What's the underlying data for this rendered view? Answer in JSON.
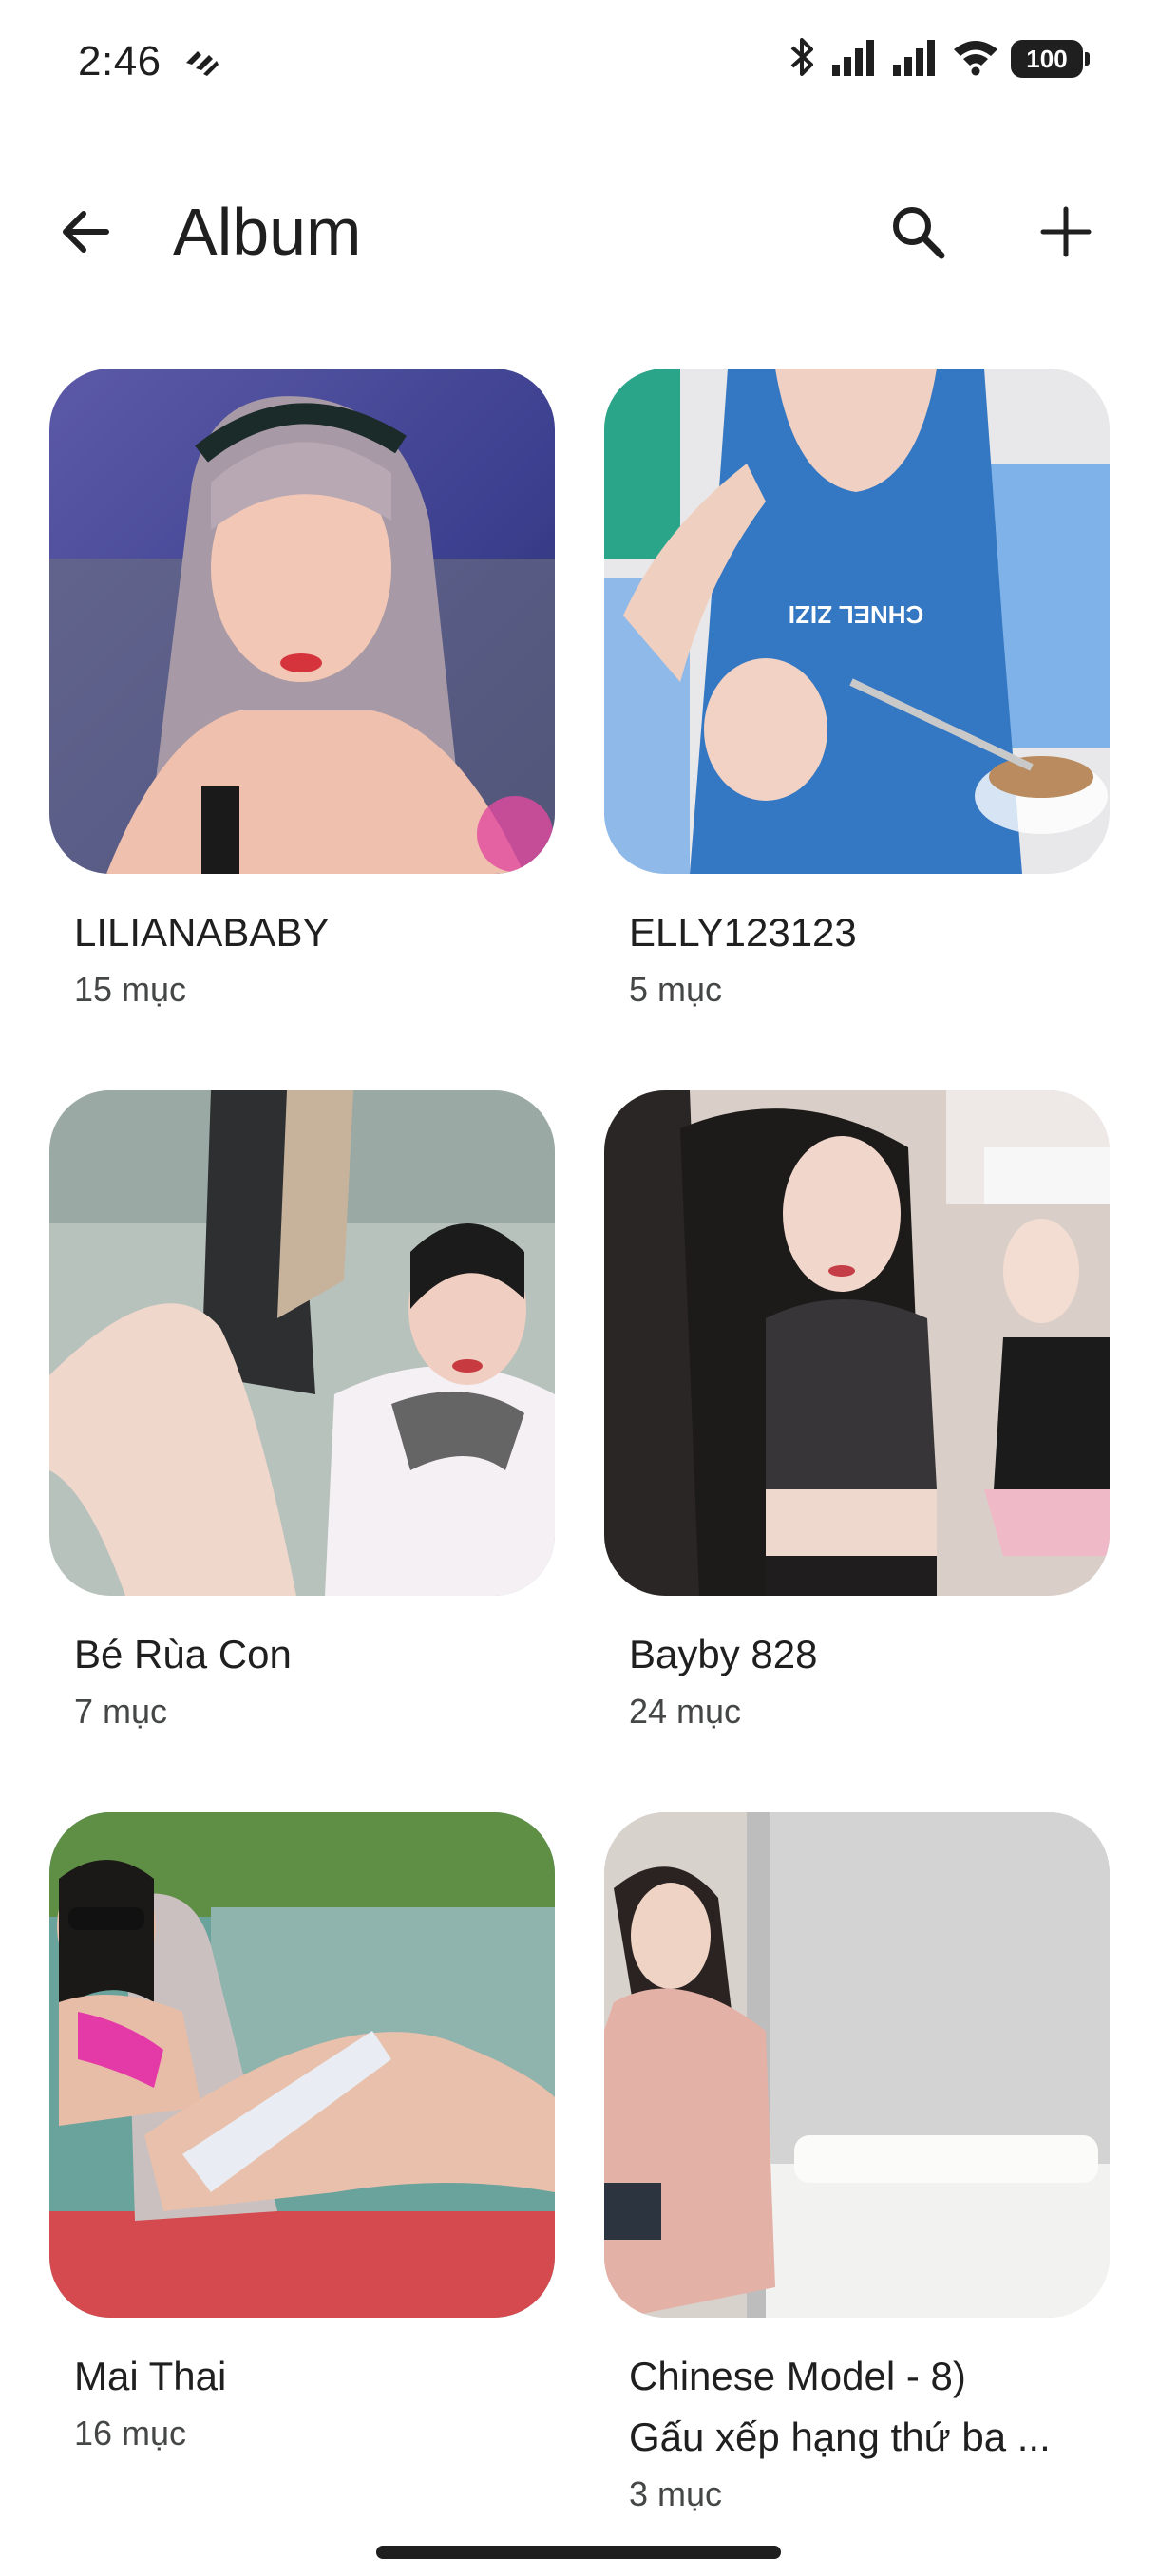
{
  "status_bar": {
    "time": "2:46",
    "battery": "100"
  },
  "app_bar": {
    "title": "Album"
  },
  "albums": [
    {
      "name": "LILIANABABY",
      "count": "15 mục"
    },
    {
      "name": "ELLY123123",
      "count": "5 mục"
    },
    {
      "name": "Bé Rùa Con",
      "count": "7 mục"
    },
    {
      "name": "Bayby 828",
      "count": "24 mục"
    },
    {
      "name": "Mai Thai",
      "count": "16 mục"
    },
    {
      "name": "Chinese Model - 8)",
      "name_line2": "Gấu xếp hạng thứ ba ...",
      "count": "3 mục"
    }
  ],
  "colors": {
    "text_primary": "#1f1f1f",
    "text_secondary": "#444746",
    "background": "#ffffff"
  }
}
